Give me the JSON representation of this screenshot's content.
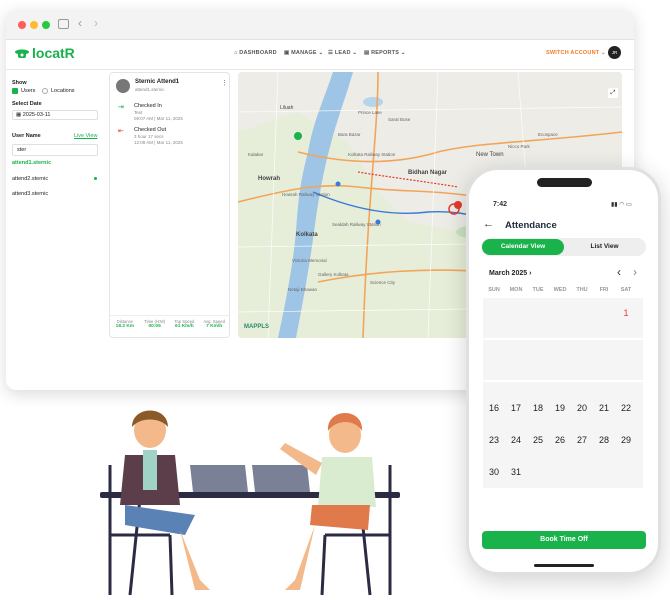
{
  "app": {
    "logo": "locatR"
  },
  "nav": {
    "dashboard": "DASHBOARD",
    "manage": "MANAGE",
    "lead": "LEAD",
    "reports": "REPORTS",
    "switch_account": "SWITCH ACCOUNT",
    "avatar": "JR"
  },
  "sidebar": {
    "show_label": "Show",
    "users": "Users",
    "locations": "Locations",
    "select_date_label": "Select Date",
    "date_value": "2025-03-11",
    "user_name_header": "User Name",
    "live_view": "Live View",
    "search_value": "ster",
    "users_list": [
      "attend1.sternic",
      "attend2.sternic",
      "attend3.sternic"
    ]
  },
  "card": {
    "name": "Sternic Attend1",
    "username": "attend1.sternic",
    "checked_in": {
      "title": "Checked In",
      "note": "Test",
      "time": "09:07 AM | Mar 11, 2025"
    },
    "checked_out": {
      "title": "Checked Out",
      "duration": "3 hour 17 secs",
      "time": "12:08 AM | Mar 11, 2025"
    },
    "stats": [
      {
        "label": "Distance",
        "value": "18.2 Km"
      },
      {
        "label": "Time (H:M)",
        "value": "00:05"
      },
      {
        "label": "Top Speed",
        "value": "61 Km/h"
      },
      {
        "label": "Avg. Speed",
        "value": "7 Km/h"
      }
    ]
  },
  "map": {
    "labels": [
      "Liluah",
      "Howrah",
      "Kolkata",
      "Bidhan Nagar",
      "New Town",
      "Science City",
      "Gallery Kolkata",
      "Netaji Bhawan",
      "Kolkata Railway Station",
      "Sealdah Railway Station",
      "Howrah Railway Station",
      "Victoria Memorial",
      "Prince Lake",
      "Sarat Bose",
      "Bara Bazar",
      "Kalakar",
      "Nicco Park",
      "Ecospace"
    ],
    "watermark": "MAPPLS"
  },
  "phone": {
    "time": "7:42",
    "title": "Attendance",
    "tab_calendar": "Calendar View",
    "tab_list": "List View",
    "month": "March 2025",
    "weekdays": [
      "SUN",
      "MON",
      "TUE",
      "WED",
      "THU",
      "FRI",
      "SAT"
    ],
    "first_day": "1",
    "weeks": [
      [
        "16",
        "17",
        "18",
        "19",
        "20",
        "21",
        "22"
      ],
      [
        "23",
        "24",
        "25",
        "26",
        "27",
        "28",
        "29"
      ],
      [
        "30",
        "31"
      ]
    ],
    "book_button": "Book Time Off"
  },
  "colors": {
    "brand_green": "#19b24b",
    "orange": "#f07b2a",
    "red": "#e23b2e"
  }
}
